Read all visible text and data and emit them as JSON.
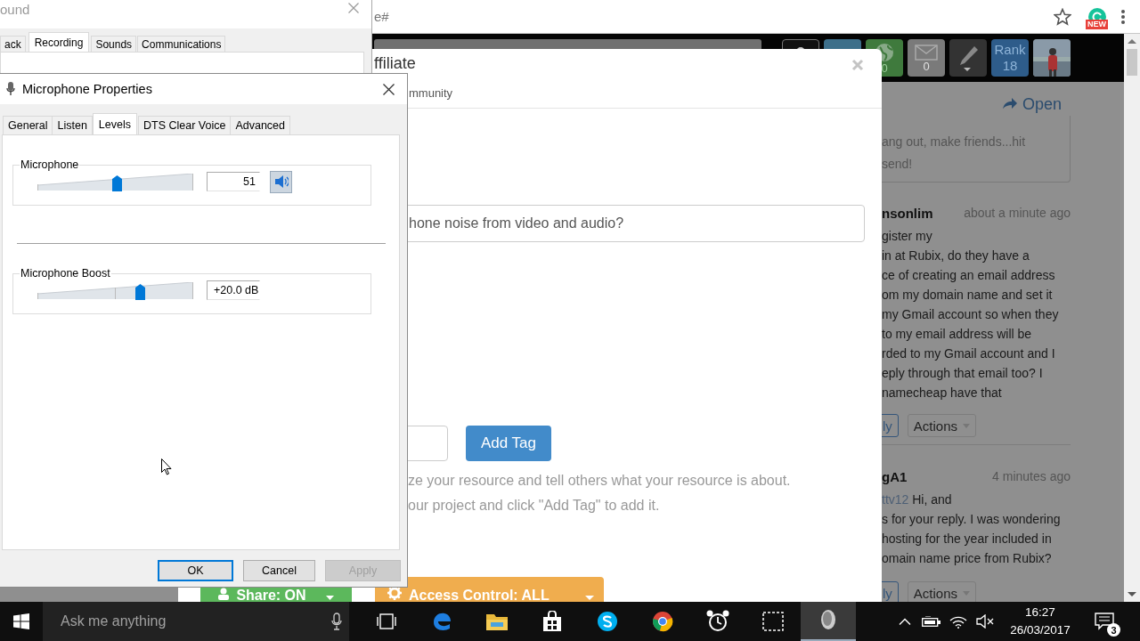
{
  "browser": {
    "address_text": "e#",
    "extension_badge": "NEW",
    "nav_tiles": [
      {
        "kind": "user"
      },
      {
        "kind": "group"
      },
      {
        "kind": "globe",
        "count": "0"
      },
      {
        "kind": "mail",
        "count": "0"
      },
      {
        "kind": "pen"
      },
      {
        "kind": "rank",
        "label": "Rank",
        "value": "18"
      },
      {
        "kind": "avatar"
      }
    ],
    "open_link": "Open",
    "intro_lines": [
      "ang out, make friends...hit",
      "send!"
    ],
    "comments": [
      {
        "author": "nsonlim",
        "time": "about a minute ago",
        "lines": [
          "gister my",
          "in at Rubix, do they have a",
          "ce of creating an email address",
          "om my domain name and set it",
          "my Gmail account so when they",
          "to my email address will be",
          "rded to my Gmail account and I",
          "eply through that email too? I",
          "namecheap have that"
        ],
        "reply": "ly",
        "actions": "Actions"
      },
      {
        "author": "gA1",
        "time": "4 minutes ago",
        "mention": "ttv12",
        "lines": [
          "Hi, and",
          "s for your reply. I was wondering",
          "hosting for the year included in",
          "omain name price from Rubix?"
        ],
        "reply": "ly",
        "actions": "Actions"
      }
    ]
  },
  "modal": {
    "title": "ffiliate",
    "subtitle": "mmunity",
    "question_value": "hone noise from video and audio?",
    "add_tag_button": "Add Tag",
    "help_lines": [
      "ze your resource and tell others what your resource is about.",
      "our project and click \"Add Tag\" to add it."
    ],
    "share_button": "Share: ON",
    "access_button": "Access Control: ALL"
  },
  "sound_dialog": {
    "title": "ound",
    "tabs": [
      {
        "label": "ack",
        "selected": false
      },
      {
        "label": "Recording",
        "selected": true
      },
      {
        "label": "Sounds",
        "selected": false
      },
      {
        "label": "Communications",
        "selected": false
      }
    ]
  },
  "mic_dialog": {
    "title": "Microphone Properties",
    "tabs": [
      {
        "label": "General",
        "selected": false
      },
      {
        "label": "Listen",
        "selected": false
      },
      {
        "label": "Levels",
        "selected": true
      },
      {
        "label": "DTS Clear Voice",
        "selected": false
      },
      {
        "label": "Advanced",
        "selected": false
      }
    ],
    "groups": [
      {
        "kind": "volume",
        "label": "Microphone",
        "level": 0.51,
        "value": "51",
        "muted": false
      },
      {
        "kind": "boost",
        "label": "Microphone Boost",
        "level": 0.67,
        "value": "+20.0 dB"
      }
    ],
    "buttons": [
      {
        "label": "OK",
        "default": true,
        "disabled": false
      },
      {
        "label": "Cancel",
        "default": false,
        "disabled": false
      },
      {
        "label": "Apply",
        "default": false,
        "disabled": true
      }
    ]
  },
  "taskbar": {
    "search_placeholder": "Ask me anything",
    "apps": [
      {
        "kind": "task-view",
        "active": false
      },
      {
        "kind": "edge",
        "active": false
      },
      {
        "kind": "explorer",
        "active": false
      },
      {
        "kind": "store",
        "active": false
      },
      {
        "kind": "skype",
        "active": false
      },
      {
        "kind": "chrome",
        "active": false
      },
      {
        "kind": "alarm",
        "active": false
      },
      {
        "kind": "snip",
        "active": false
      },
      {
        "kind": "recorder",
        "active": true
      }
    ],
    "time": "16:27",
    "date": "26/03/2017",
    "notification_count": "3"
  }
}
